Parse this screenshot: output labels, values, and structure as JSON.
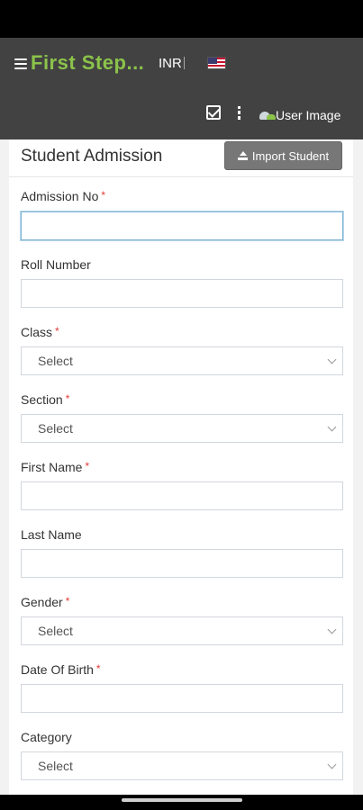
{
  "header": {
    "brand": "First Step...",
    "currency": "INR",
    "user_image_label": "User Image"
  },
  "page": {
    "title": "Student Admission",
    "import_button": "Import Student"
  },
  "form": {
    "fields": [
      {
        "label": "Admission No",
        "required": "*",
        "type": "text",
        "value": ""
      },
      {
        "label": "Roll Number",
        "required": "",
        "type": "text",
        "value": ""
      },
      {
        "label": "Class",
        "required": "*",
        "type": "select",
        "value": "Select"
      },
      {
        "label": "Section",
        "required": "*",
        "type": "select",
        "value": "Select"
      },
      {
        "label": "First Name",
        "required": "*",
        "type": "text",
        "value": ""
      },
      {
        "label": "Last Name",
        "required": "",
        "type": "text",
        "value": ""
      },
      {
        "label": "Gender",
        "required": "*",
        "type": "select",
        "value": "Select"
      },
      {
        "label": "Date Of Birth",
        "required": "*",
        "type": "text",
        "value": ""
      },
      {
        "label": "Category",
        "required": "",
        "type": "select",
        "value": "Select"
      }
    ]
  },
  "colors": {
    "topbar": "#424242",
    "brand": "#8bc34a",
    "required": "#e53935",
    "import_button": "#777777"
  }
}
